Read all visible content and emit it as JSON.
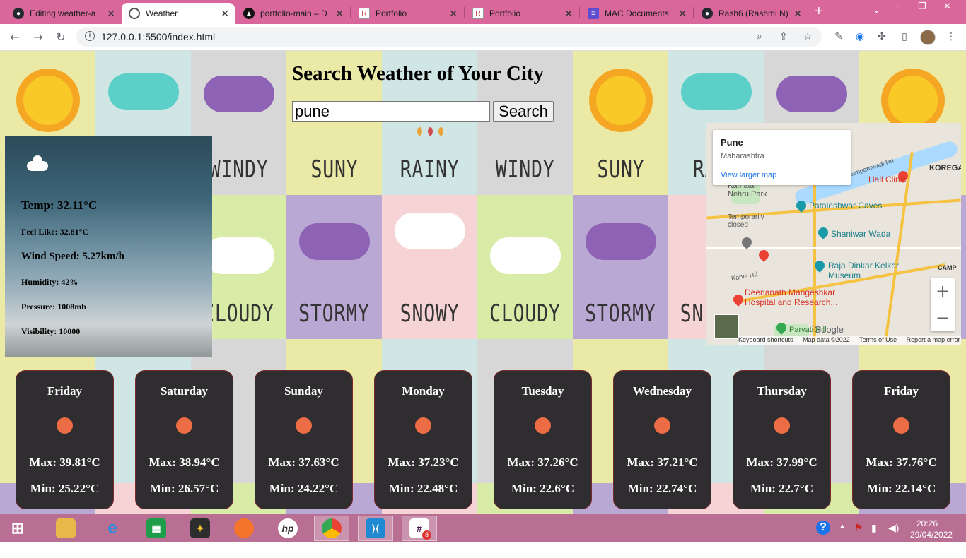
{
  "browser": {
    "tabs": [
      {
        "title": "Editing weather-a",
        "favicon": "github-icon",
        "active": false
      },
      {
        "title": "Weather",
        "favicon": "globe-icon",
        "active": true
      },
      {
        "title": "portfolio-main – D",
        "favicon": "vercel-icon",
        "active": false
      },
      {
        "title": "Portfolio",
        "favicon": "portfolio-icon",
        "active": false
      },
      {
        "title": "Portfolio",
        "favicon": "portfolio-icon",
        "active": false
      },
      {
        "title": "MAC Documents",
        "favicon": "forms-icon",
        "active": false
      },
      {
        "title": "Rash6 (Rashmi N)",
        "favicon": "github-icon",
        "active": false
      }
    ],
    "url": "127.0.0.1:5500/index.html",
    "tab_close_glyph": "✕",
    "new_tab_glyph": "+"
  },
  "page": {
    "title": "Search Weather of Your City",
    "search_value": "pune",
    "search_button": "Search",
    "background_words": [
      "WINDY",
      "SUNY",
      "RAINY",
      "WINDY",
      "SUNY",
      "RA",
      "CLOUDY",
      "STORMY",
      "SNOWY",
      "CLOUDY",
      "STORMY",
      "SN"
    ]
  },
  "current": {
    "temp": "Temp: 32.11°C",
    "feels_like": "Feel Like: 32.81°C",
    "wind": "Wind Speed: 5.27km/h",
    "humidity": "Humidity: 42%",
    "pressure": "Pressure: 1008mb",
    "visibility": "Visibility: 10000"
  },
  "map": {
    "place": "Pune",
    "region": "Maharashtra",
    "larger_link": "View larger map",
    "labels": {
      "koregaon": "KOREGA",
      "hall_clinic": "Hall Clinic",
      "kamala_nehru_park": "Kamala Nehru Park",
      "pataleshwar": "Pataleshwar Caves",
      "temp_closed": "Temporarily closed",
      "shaniwar_wada": "Shaniwar Wada",
      "raja_dinkar": "Raja Dinkar Kelkar Museum",
      "deenanath": "Deenanath Mangeshkar Hospital and Research...",
      "parvati": "Parvati Hill",
      "karve_rd": "Karve Rd",
      "camp": "CAMP",
      "sangamwadi": "Sangamwadi Rd",
      "google": "Google"
    },
    "footer": [
      "Keyboard shortcuts",
      "Map data ©2022",
      "Terms of Use",
      "Report a map error"
    ],
    "zoom_in": "+",
    "zoom_out": "−"
  },
  "forecast": [
    {
      "day": "Friday",
      "max": "Max: 39.81°C",
      "min": "Min: 25.22°C"
    },
    {
      "day": "Saturday",
      "max": "Max: 38.94°C",
      "min": "Min: 26.57°C"
    },
    {
      "day": "Sunday",
      "max": "Max: 37.63°C",
      "min": "Min: 24.22°C"
    },
    {
      "day": "Monday",
      "max": "Max: 37.23°C",
      "min": "Min: 22.48°C"
    },
    {
      "day": "Tuesday",
      "max": "Max: 37.26°C",
      "min": "Min: 22.6°C"
    },
    {
      "day": "Wednesday",
      "max": "Max: 37.21°C",
      "min": "Min: 22.74°C"
    },
    {
      "day": "Thursday",
      "max": "Max: 37.99°C",
      "min": "Min: 22.7°C"
    },
    {
      "day": "Friday",
      "max": "Max: 37.76°C",
      "min": "Min: 22.14°C"
    }
  ],
  "taskbar": {
    "time": "20:26",
    "date": "29/04/2022",
    "slack_badge": "8",
    "apps": [
      "windows-start-icon",
      "file-explorer-icon",
      "internet-explorer-icon",
      "store-icon",
      "paint-icon",
      "firefox-icon",
      "hp-icon",
      "chrome-icon",
      "vscode-icon",
      "slack-icon"
    ]
  },
  "colors": {
    "tabbar": "#d9679c",
    "taskbar": "#b96f93",
    "forecast_card": "#2f2d2f",
    "sun_dot": "#ec6c45"
  }
}
